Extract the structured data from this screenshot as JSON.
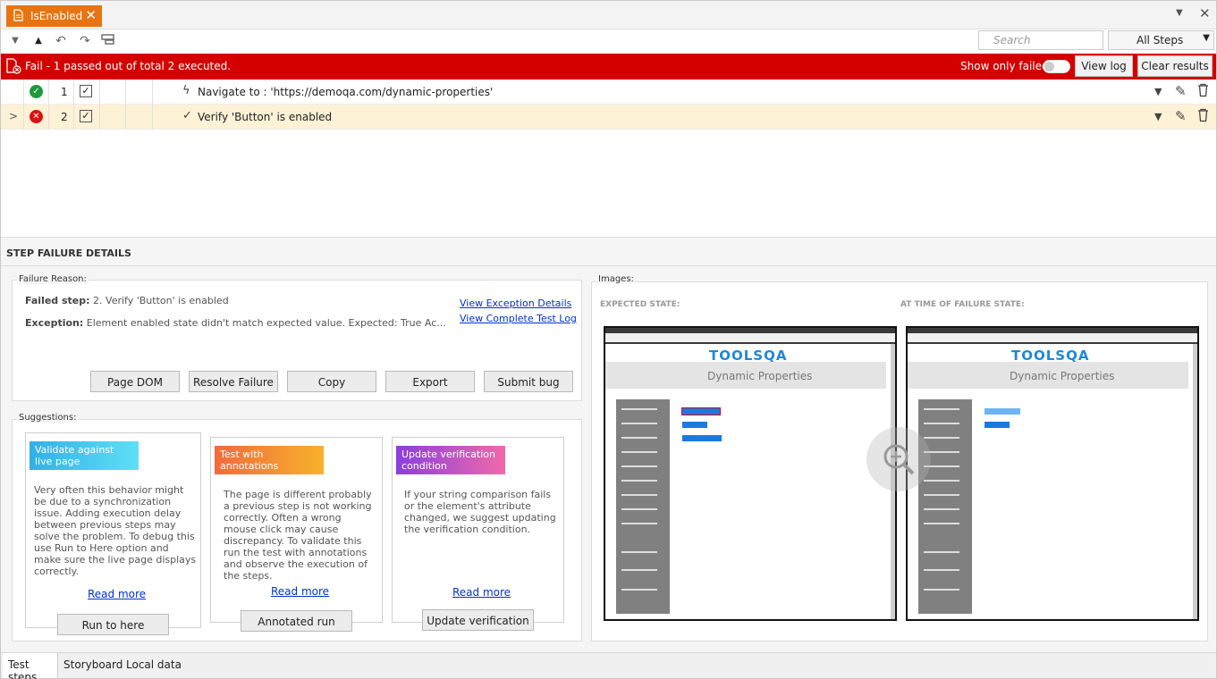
{
  "tab": {
    "title": "IsEnabled",
    "close": "✕"
  },
  "toolbar": {
    "search_placeholder": "Search",
    "filter_label": "All Steps"
  },
  "status": {
    "text": "Fail - 1 passed out of total 2 executed.",
    "show_only_failed_label": "Show only failed",
    "view_log_label": "View log",
    "clear_results_label": "Clear results"
  },
  "steps": [
    {
      "number": "1",
      "text": "Navigate to : 'https://demoqa.com/dynamic-properties'",
      "status": "pass"
    },
    {
      "number": "2",
      "text": "Verify 'Button' is enabled",
      "status": "fail"
    }
  ],
  "failure": {
    "section_title": "STEP FAILURE DETAILS",
    "reason_legend": "Failure Reason:",
    "failed_step_label": "Failed step:",
    "failed_step_value": "2. Verify 'Button' is enabled",
    "exception_label": "Exception:",
    "exception_value": "Element enabled state didn't match expected value. Expected: True Ac...",
    "view_exception_link": "View Exception Details",
    "view_log_link": "View Complete Test Log",
    "buttons": [
      "Page DOM",
      "Resolve Failure",
      "Copy",
      "Export",
      "Submit bug"
    ]
  },
  "suggestions": {
    "legend": "Suggestions:",
    "cards": [
      {
        "title": "Validate against live page",
        "body": "Very often this behavior might be due to a synchronization issue. Adding execution delay between previous steps may solve the problem. To debug this use Run to Here option and make sure the live page displays correctly.",
        "read_more": "Read more",
        "action": "Run to here",
        "color1": "#31b0e8",
        "color2": "#5ee0f5"
      },
      {
        "title": "Test with annotations",
        "body": "The page is different probably a previous step is not working correctly. Often a wrong mouse click may cause discrepancy. To validate this run the test with annotations and observe the execution of the steps.",
        "read_more": "Read more",
        "action": "Annotated run",
        "color1": "#f26a3c",
        "color2": "#f7b22b"
      },
      {
        "title": "Update verification condition",
        "body": "If your string comparison fails or the element's attribute changed, we suggest updating the verification condition.",
        "read_more": "Read more",
        "action": "Update verification",
        "color1": "#8a3ee0",
        "color2": "#f06aa8"
      }
    ]
  },
  "images": {
    "legend": "Images:",
    "expected_label": "EXPECTED STATE:",
    "failure_label": "AT TIME OF FAILURE STATE:",
    "page_logo": "TOOLSQA",
    "page_heading": "Dynamic Properties"
  },
  "bottom_tabs": [
    "Test steps",
    "Storyboard",
    "Local data"
  ]
}
